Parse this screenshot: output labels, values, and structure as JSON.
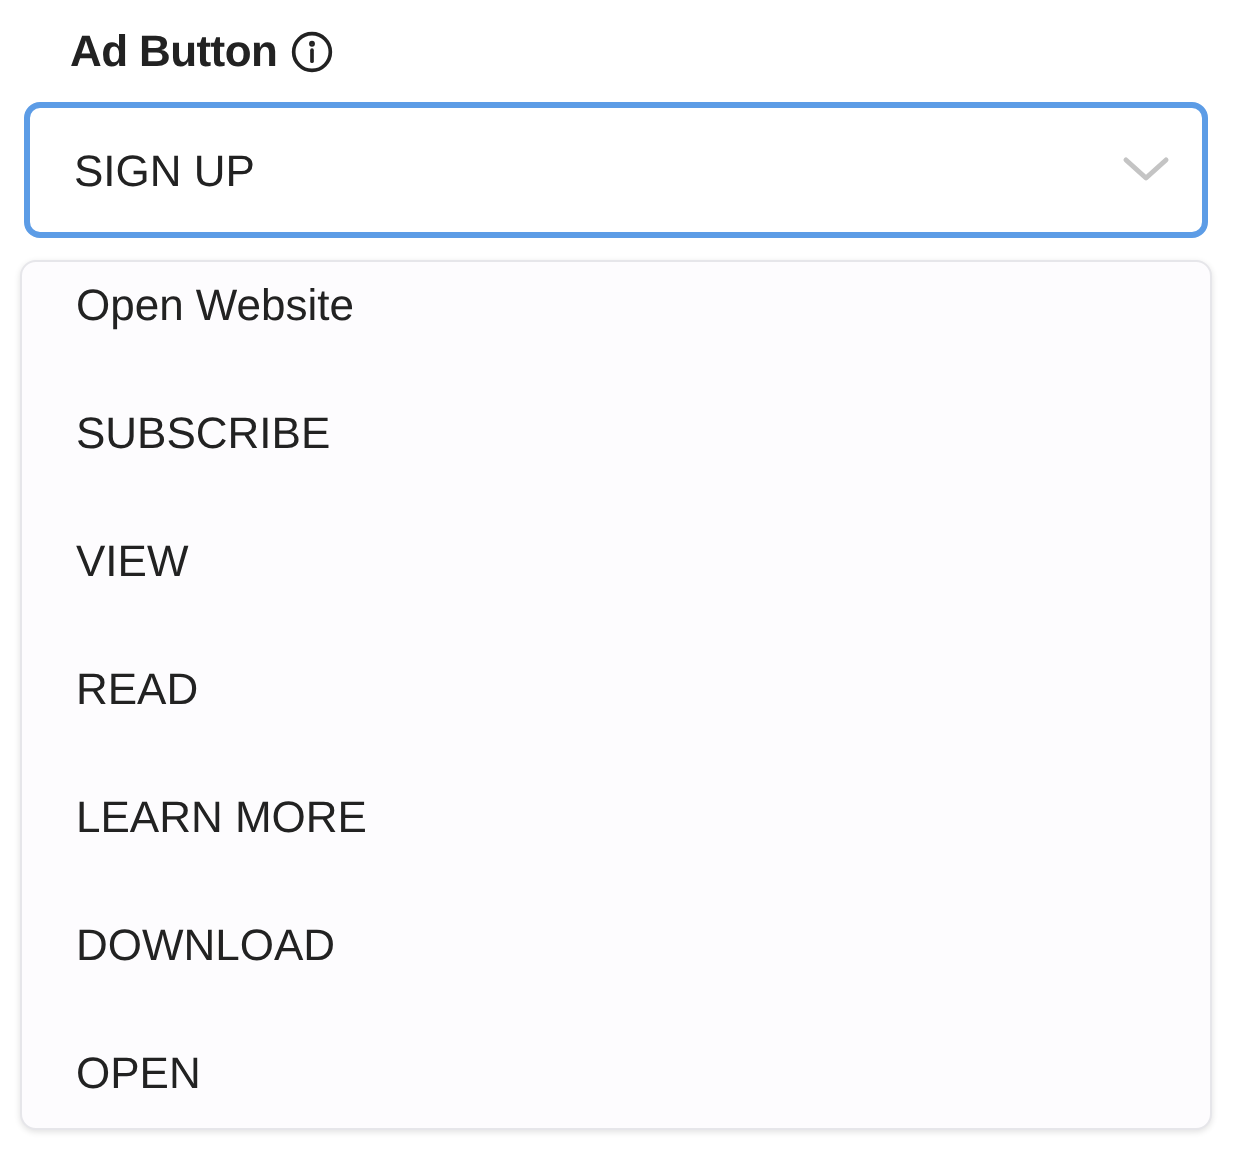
{
  "field": {
    "label": "Ad Button",
    "value": "SIGN UP",
    "expanded": true
  },
  "options": [
    "Open Website",
    "SUBSCRIBE",
    "VIEW",
    "READ",
    "LEARN MORE",
    "DOWNLOAD",
    "OPEN"
  ]
}
